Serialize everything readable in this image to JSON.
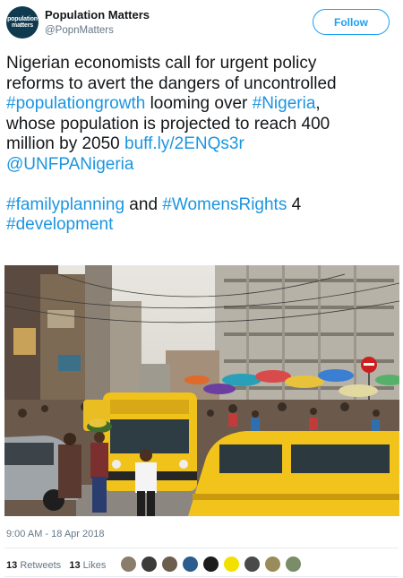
{
  "account": {
    "avatar_text_line1": "population",
    "avatar_text_line2": "matters",
    "name": "Population Matters",
    "handle": "@PopnMatters",
    "follow_label": "Follow"
  },
  "tweet": {
    "line1": "Nigerian economists call for urgent policy",
    "line2": "reforms to avert the dangers of uncontrolled",
    "hashtag_populationgrowth": "#populationgrowth",
    "text_looming": " looming over ",
    "hashtag_nigeria": "#Nigeria",
    "text_comma": ",",
    "line4": "whose population is projected to reach 400",
    "text_million": "million by 2050 ",
    "link_url": "buff.ly/2ENQs3r",
    "mention_unfpa": "@UNFPANigeria",
    "hashtag_familyplanning": "#familyplanning",
    "text_and": " and ",
    "hashtag_womensrights": "#WomensRights",
    "text_4": " 4",
    "hashtag_development": "#development"
  },
  "meta": {
    "timestamp": "9:00 AM - 18 Apr 2018",
    "retweets_count": "13",
    "retweets_label": "Retweets",
    "likes_count": "13",
    "likes_label": "Likes"
  },
  "likers": [
    "#8a7d6b",
    "#3d3a3a",
    "#6d5f4e",
    "#2c5d8f",
    "#1c1c1c",
    "#f2e100",
    "#4a4a4a",
    "#9a8c5a",
    "#7b8c6a"
  ],
  "colors": {
    "link": "#1b95e0",
    "follow": "#1da1f2",
    "secondary_text": "#657786"
  }
}
